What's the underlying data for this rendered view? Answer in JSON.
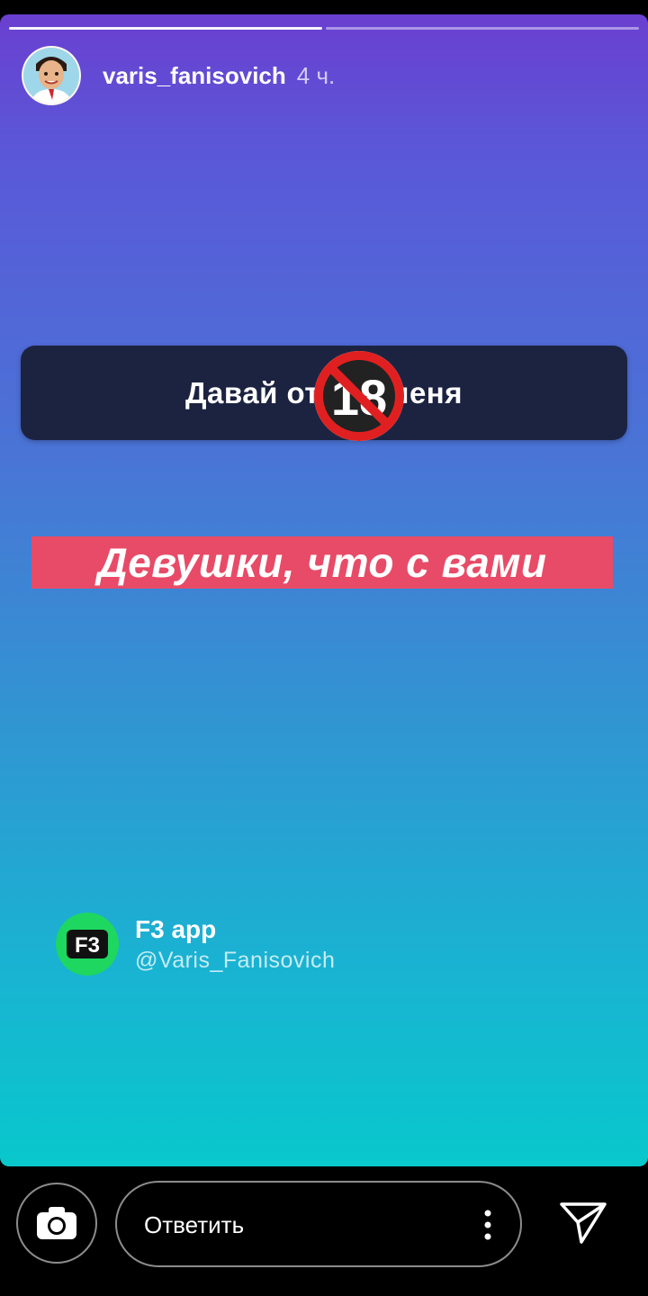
{
  "story": {
    "progress_segments": 2,
    "user": {
      "username": "varis_fanisovich",
      "time": "4 ч."
    },
    "question_sticker": {
      "text": "Давай отк      меня",
      "overlay_icon": "no-under-18-icon"
    },
    "caption": {
      "text": "Девушки, что с вами"
    },
    "attribution": {
      "app_name": "F3 app",
      "handle": "@Varis_Fanisovich",
      "logo_text": "F3"
    }
  },
  "bottom_bar": {
    "camera_icon": "camera-icon",
    "reply_placeholder": "Ответить",
    "more_icon": "more-vertical-icon",
    "send_icon": "send-icon"
  },
  "colors": {
    "caption_bg": "#e84b67",
    "sticker_bg": "#1c2340",
    "f3_green": "#1ed760",
    "no18_red": "#e02020"
  }
}
